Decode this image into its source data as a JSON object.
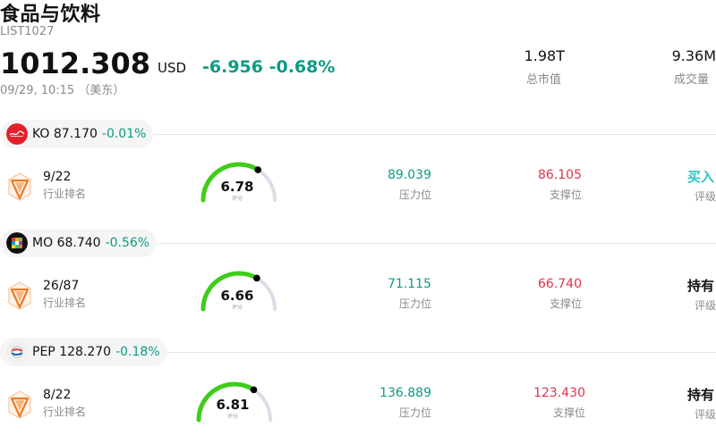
{
  "header": {
    "title": "食品与饮料",
    "code": "LIST1027",
    "price": "1012.308",
    "currency": "USD",
    "change": "-6.956 -0.68%",
    "time": "09/29, 10:15 （美东）",
    "market_cap_value": "1.98T",
    "market_cap_label": "总市值",
    "volume_value": "9.36M",
    "volume_label": "成交量"
  },
  "stocks": [
    {
      "ticker": "KO",
      "price": "87.170",
      "change_pct": "-0.01%",
      "rank": "9/22",
      "rank_label": "行业排名",
      "score": "6.78",
      "score_label": "评分",
      "score_level": 0.678,
      "resistance": "89.039",
      "resistance_label": "压力位",
      "support": "86.105",
      "support_label": "支撑位",
      "rating": "买入",
      "rating_label": "评级",
      "rating_color": "#2fc3c3",
      "logo_color": "#e41e2b"
    },
    {
      "ticker": "MO",
      "price": "68.740",
      "change_pct": "-0.56%",
      "rank": "26/87",
      "rank_label": "行业排名",
      "score": "6.66",
      "score_label": "评分",
      "score_level": 0.666,
      "resistance": "71.115",
      "resistance_label": "压力位",
      "support": "66.740",
      "support_label": "支撑位",
      "rating": "持有",
      "rating_label": "评级",
      "rating_color": "#111111",
      "logo_color": "#111111"
    },
    {
      "ticker": "PEP",
      "price": "128.270",
      "change_pct": "-0.18%",
      "rank": "8/22",
      "rank_label": "行业排名",
      "score": "6.81",
      "score_label": "评分",
      "score_level": 0.681,
      "resistance": "136.889",
      "resistance_label": "压力位",
      "support": "123.430",
      "support_label": "支撑位",
      "rating": "持有",
      "rating_label": "评级",
      "rating_color": "#111111",
      "logo_color": "#dcdcdc"
    }
  ],
  "colors": {
    "up_green": "#0f9a84",
    "support_red": "#e0334b",
    "gauge_green": "#3fcc1a",
    "gauge_track": "#dcdce6",
    "rank_orange": "#f07a22"
  }
}
